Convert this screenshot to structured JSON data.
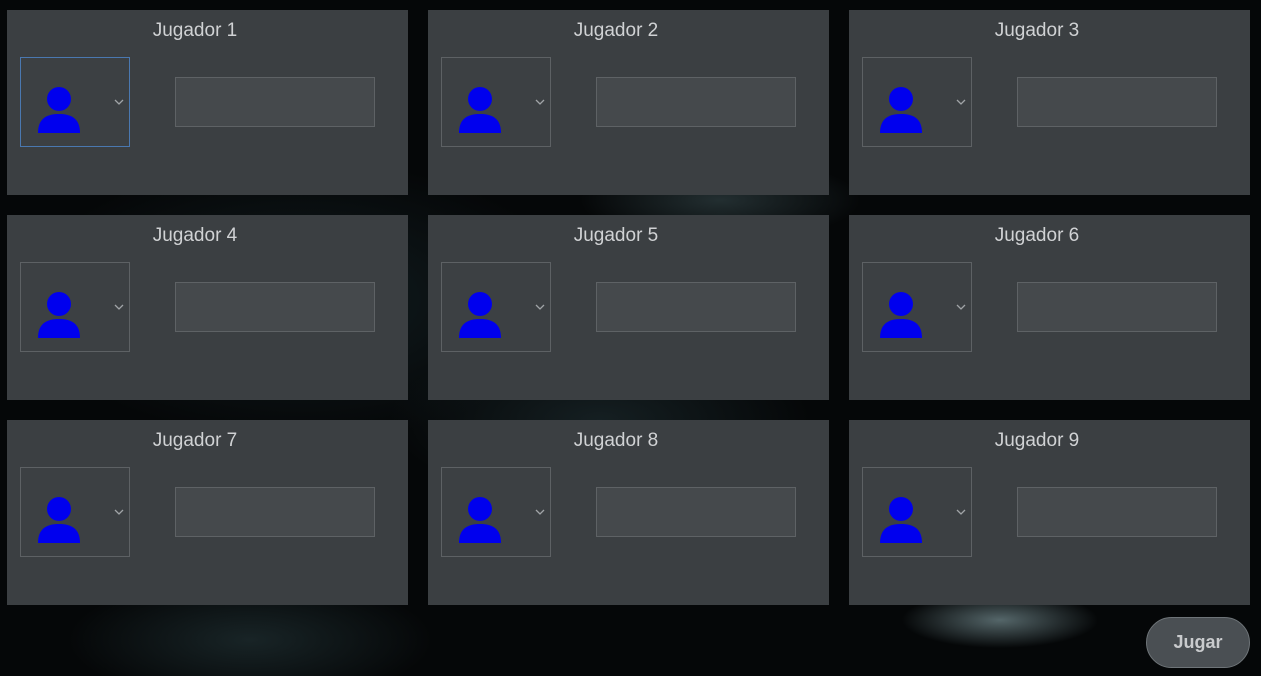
{
  "players": [
    {
      "title": "Jugador 1",
      "name_value": "",
      "avatar_icon": "user-icon"
    },
    {
      "title": "Jugador 2",
      "name_value": "",
      "avatar_icon": "user-icon"
    },
    {
      "title": "Jugador 3",
      "name_value": "",
      "avatar_icon": "user-icon"
    },
    {
      "title": "Jugador 4",
      "name_value": "",
      "avatar_icon": "user-icon"
    },
    {
      "title": "Jugador 5",
      "name_value": "",
      "avatar_icon": "user-icon"
    },
    {
      "title": "Jugador 6",
      "name_value": "",
      "avatar_icon": "user-icon"
    },
    {
      "title": "Jugador 7",
      "name_value": "",
      "avatar_icon": "user-icon"
    },
    {
      "title": "Jugador 8",
      "name_value": "",
      "avatar_icon": "user-icon"
    },
    {
      "title": "Jugador 9",
      "name_value": "",
      "avatar_icon": "user-icon"
    }
  ],
  "play_button": {
    "label": "Jugar"
  },
  "colors": {
    "avatar": "#0000ee",
    "panel": "#3b3f42",
    "focus_border": "#4a78b0"
  }
}
